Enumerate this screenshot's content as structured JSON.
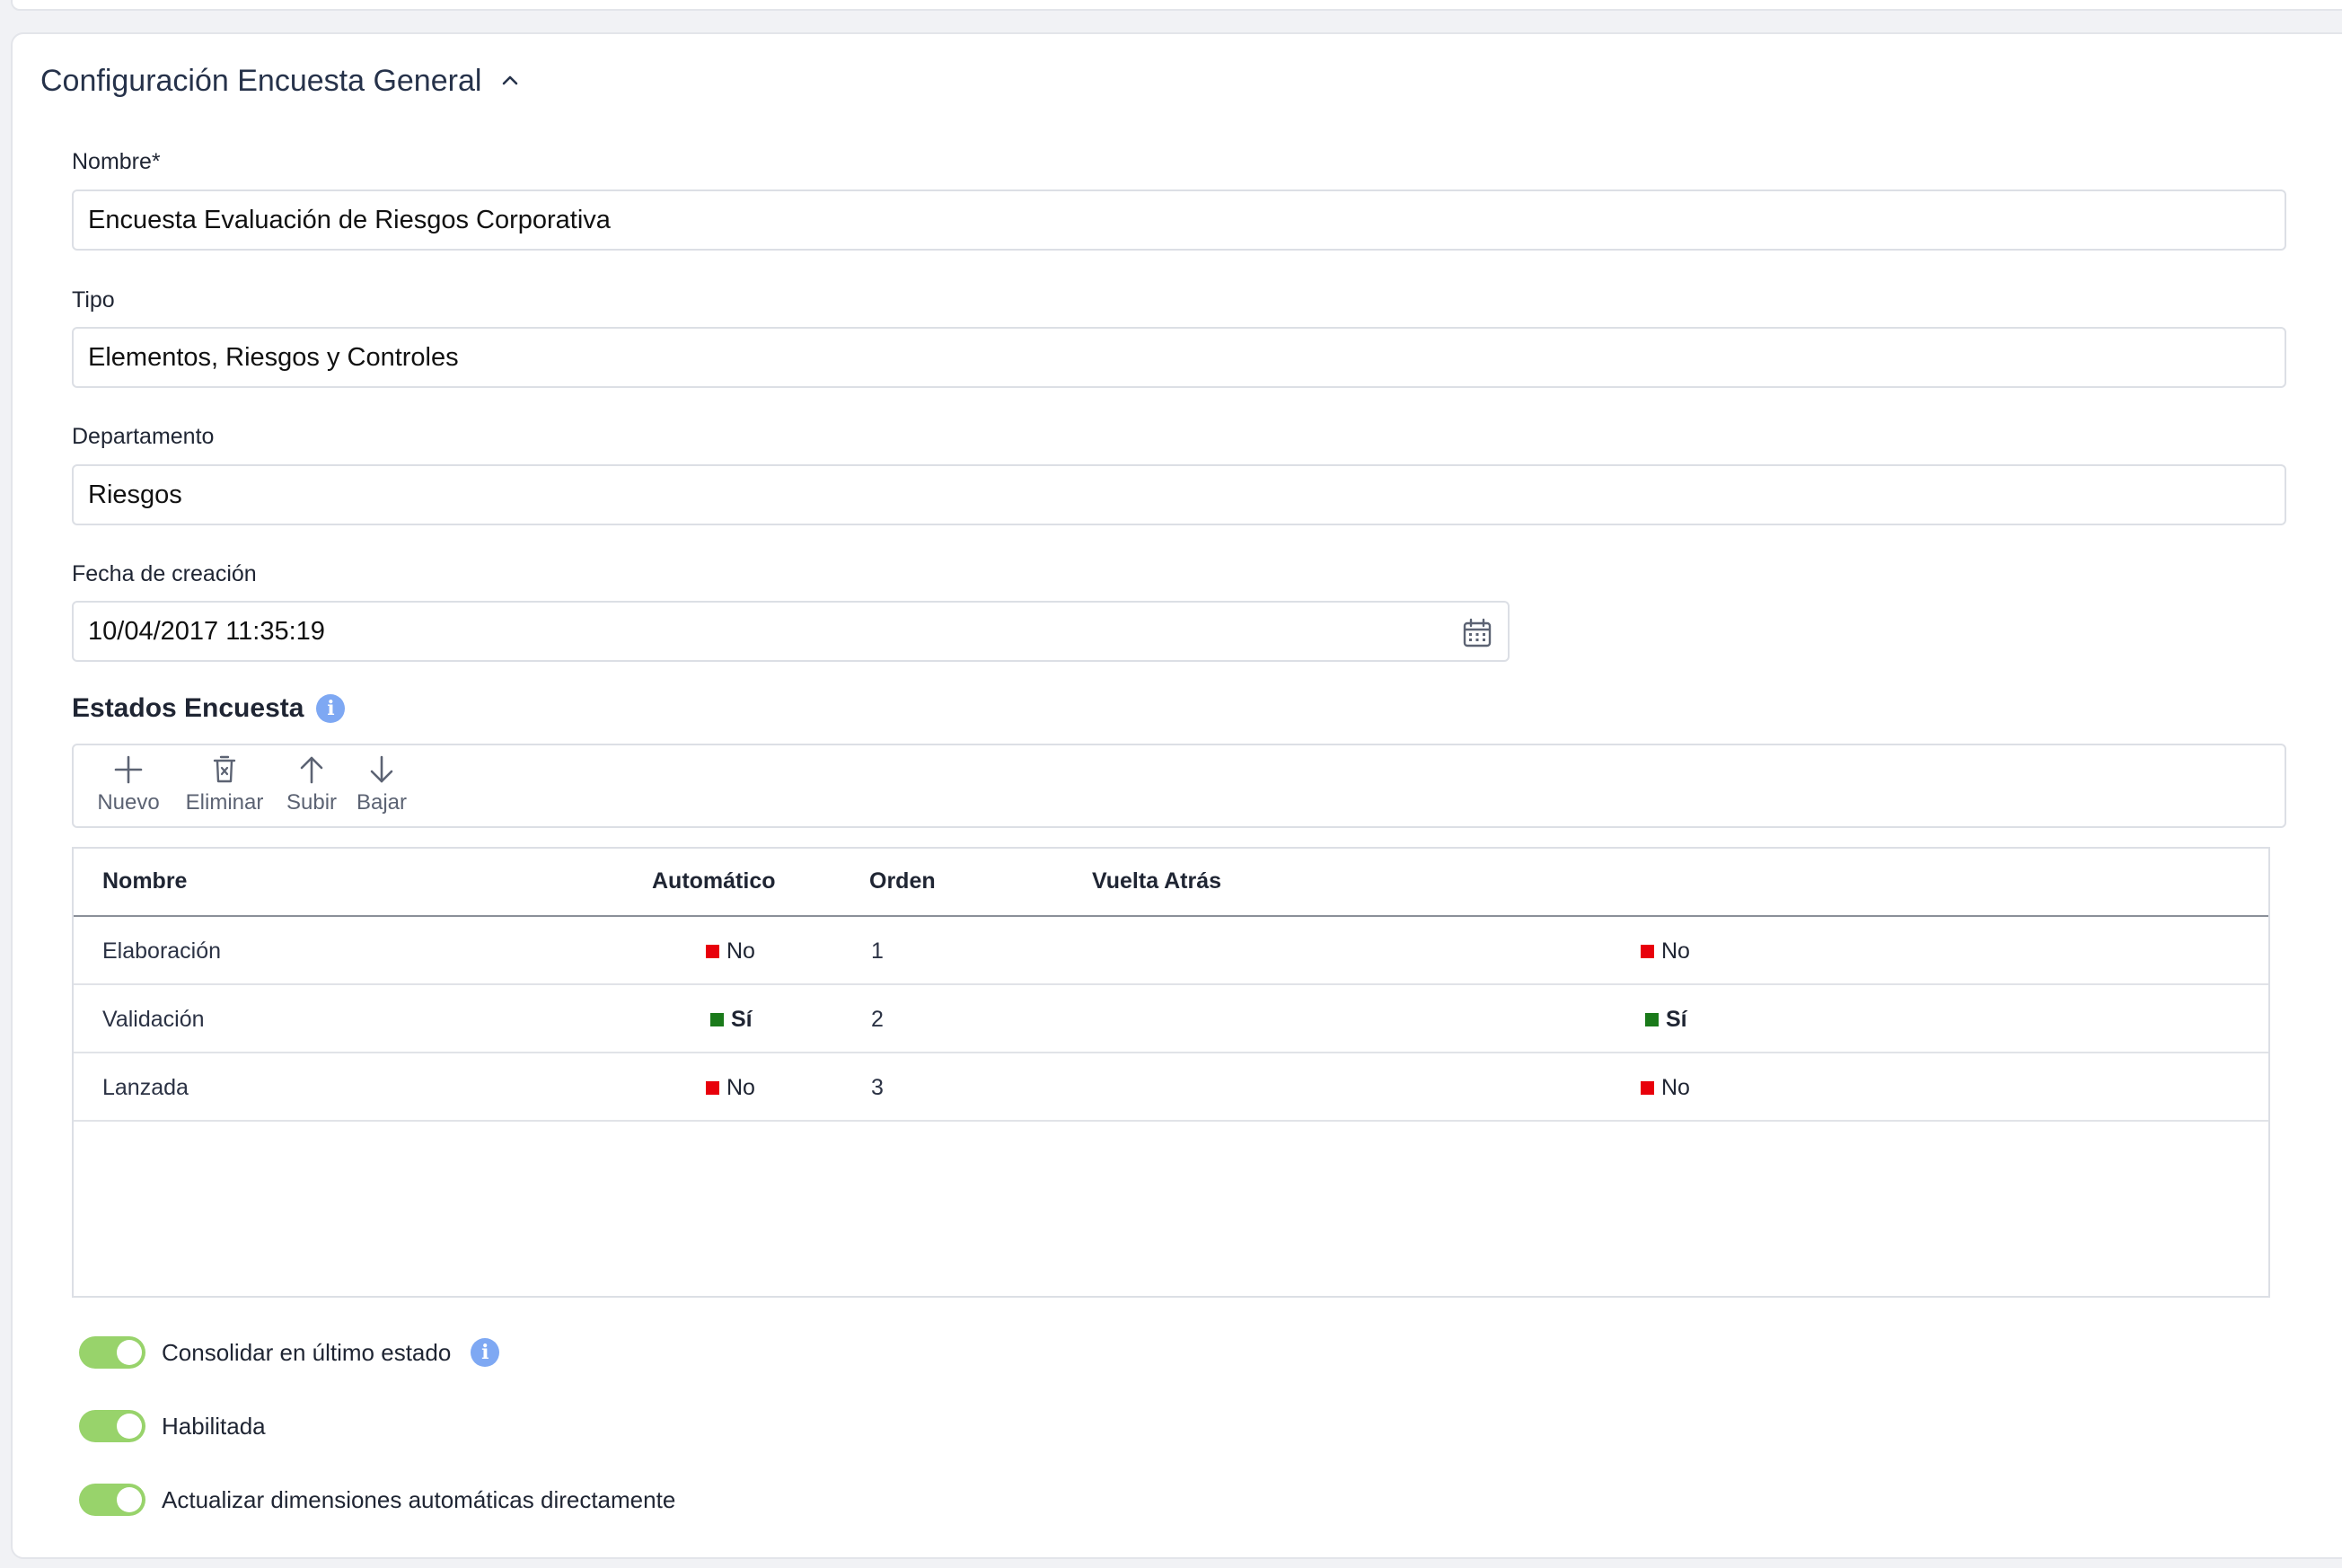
{
  "section": {
    "title": "Configuración Encuesta General"
  },
  "fields": {
    "nombre": {
      "label": "Nombre*",
      "value": "Encuesta Evaluación de Riesgos Corporativa"
    },
    "tipo": {
      "label": "Tipo",
      "value": "Elementos, Riesgos y Controles"
    },
    "departamento": {
      "label": "Departamento",
      "value": "Riesgos"
    },
    "fecha": {
      "label": "Fecha de creación",
      "value": "10/04/2017 11:35:19"
    }
  },
  "estados": {
    "title": "Estados Encuesta",
    "toolbar": {
      "nuevo": "Nuevo",
      "eliminar": "Eliminar",
      "subir": "Subir",
      "bajar": "Bajar"
    },
    "columns": {
      "nombre": "Nombre",
      "automatico": "Automático",
      "orden": "Orden",
      "vuelta_atras": "Vuelta Atrás"
    },
    "rows": [
      {
        "nombre": "Elaboración",
        "automatico": "No",
        "orden": "1",
        "vuelta_atras": "No"
      },
      {
        "nombre": "Validación",
        "automatico": "Sí",
        "orden": "2",
        "vuelta_atras": "Sí"
      },
      {
        "nombre": "Lanzada",
        "automatico": "No",
        "orden": "3",
        "vuelta_atras": "No"
      }
    ]
  },
  "toggles": {
    "consolidar": {
      "label": "Consolidar en último estado",
      "on": true
    },
    "habilitada": {
      "label": "Habilitada",
      "on": true
    },
    "actualizar": {
      "label": "Actualizar dimensiones automáticas directamente",
      "on": true
    }
  },
  "colors": {
    "no_flag": "#e8000b",
    "yes_flag": "#1a7a1a",
    "toggle_on": "#98d36b",
    "info": "#7ea8f3"
  },
  "icons": {
    "info": "i",
    "collapse": "chevron-up-icon",
    "calendar": "calendar-icon"
  }
}
